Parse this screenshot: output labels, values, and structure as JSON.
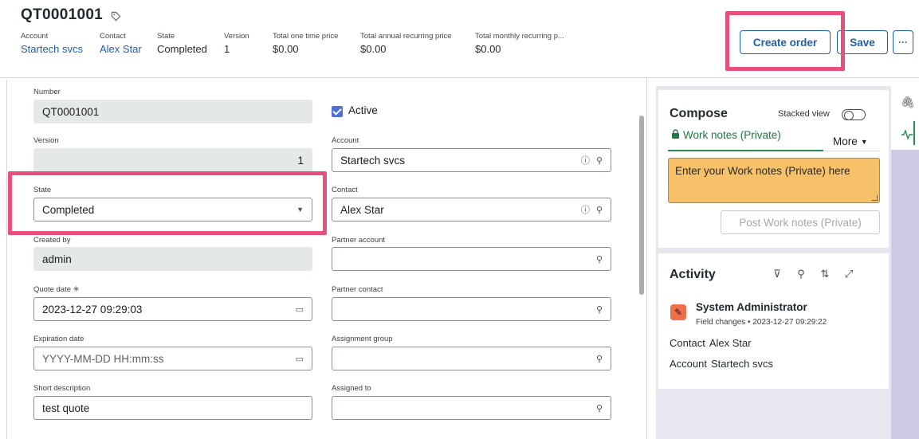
{
  "header": {
    "record_number": "QT0001001",
    "tag_icon": "tag-icon",
    "fields": [
      {
        "label": "Account",
        "value": "Startech svcs"
      },
      {
        "label": "Contact",
        "value": "Alex Star"
      },
      {
        "label": "State",
        "value": "Completed"
      },
      {
        "label": "Version",
        "value": "1"
      },
      {
        "label": "Total one time price",
        "value": "$0.00"
      },
      {
        "label": "Total annual recurring price",
        "value": "$0.00"
      },
      {
        "label": "Total monthly recurring p...",
        "value": "$0.00"
      }
    ],
    "create_order_label": "Create order",
    "save_label": "Save",
    "more_label": "···"
  },
  "form": {
    "number": {
      "label": "Number",
      "value": "QT0001001"
    },
    "active": {
      "label": "Active",
      "checked": true
    },
    "version": {
      "label": "Version",
      "value": "1"
    },
    "account": {
      "label": "Account",
      "value": "Startech svcs"
    },
    "state": {
      "label": "State",
      "value": "Completed"
    },
    "contact": {
      "label": "Contact",
      "value": "Alex Star"
    },
    "created_by": {
      "label": "Created by",
      "value": "admin"
    },
    "partner_account": {
      "label": "Partner account",
      "value": ""
    },
    "quote_date": {
      "label": "Quote date",
      "required_mark": "✳",
      "value": "2023-12-27 09:29:03"
    },
    "partner_contact": {
      "label": "Partner contact",
      "value": ""
    },
    "expiration_date": {
      "label": "Expiration date",
      "placeholder": "YYYY-MM-DD HH:mm:ss"
    },
    "assignment_group": {
      "label": "Assignment group",
      "value": ""
    },
    "short_description": {
      "label": "Short description",
      "value": "test quote"
    },
    "assigned_to": {
      "label": "Assigned to",
      "value": ""
    }
  },
  "compose": {
    "title": "Compose",
    "stacked_view_label": "Stacked view",
    "work_notes_tab": "Work notes (Private)",
    "more_label": "More",
    "notes_placeholder": "Enter your Work notes (Private) here",
    "post_button": "Post Work notes (Private)"
  },
  "activity": {
    "title": "Activity",
    "entry": {
      "user": "System Administrator",
      "type": "Field changes",
      "separator": "•",
      "timestamp": "2023-12-27 09:29:22",
      "changes": [
        {
          "field": "Contact",
          "value": "Alex Star"
        },
        {
          "field": "Account",
          "value": "Startech svcs"
        }
      ]
    }
  },
  "colors": {
    "link": "#1f5fa8",
    "highlight": "#e84f7c",
    "notes_bg": "#f7c16a",
    "work_notes_tab": "#1e7a43",
    "checkbox": "#4d6fd6"
  }
}
